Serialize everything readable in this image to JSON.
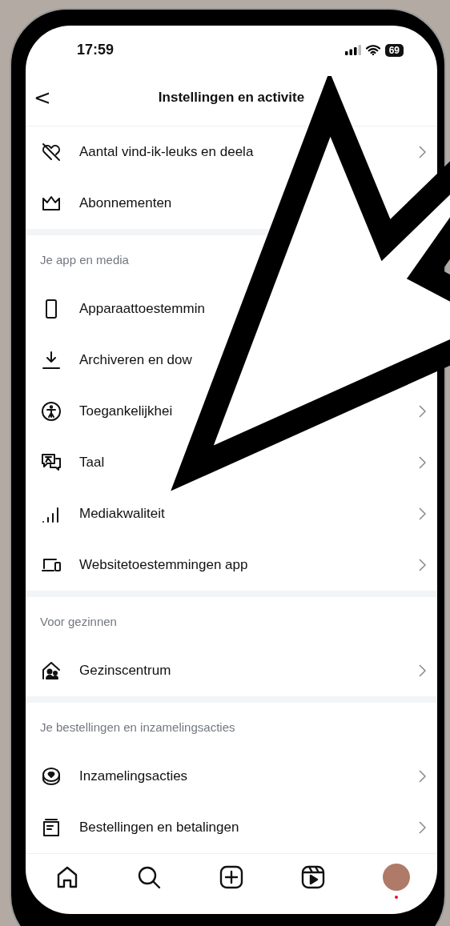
{
  "status_bar": {
    "time": "17:59",
    "battery": "69"
  },
  "header": {
    "back": "<",
    "title": "Instellingen en activite"
  },
  "sections": [
    {
      "items": [
        {
          "label": "Aantal vind-ik-leuks en deela"
        },
        {
          "label": "Abonnementen"
        }
      ]
    },
    {
      "title": "Je app en media",
      "items": [
        {
          "label": "Apparaattoestemmin"
        },
        {
          "label": "Archiveren en dow"
        },
        {
          "label": "Toegankelijkhei"
        },
        {
          "label": "Taal"
        },
        {
          "label": "Mediakwaliteit"
        },
        {
          "label": "Websitetoestemmingen app"
        }
      ]
    },
    {
      "title": "Voor gezinnen",
      "items": [
        {
          "label": "Gezinscentrum"
        }
      ]
    },
    {
      "title": "Je bestellingen en inzamelingsacties",
      "items": [
        {
          "label": "Inzamelingsacties"
        },
        {
          "label": "Bestellingen en betalingen"
        }
      ]
    }
  ],
  "nav": {
    "profile_notification": true
  }
}
